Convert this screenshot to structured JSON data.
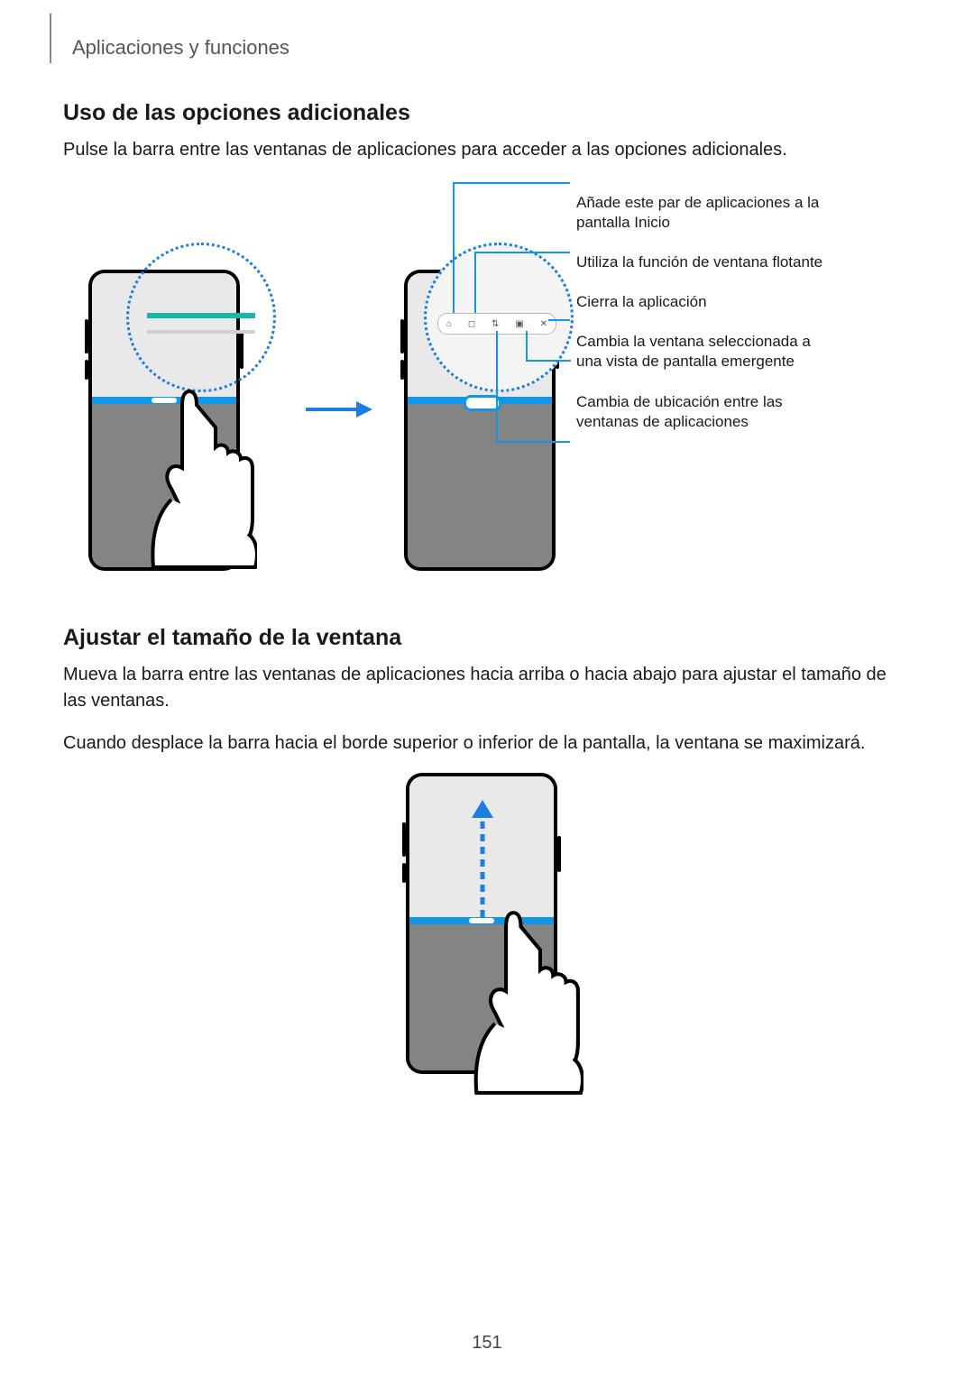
{
  "breadcrumb": "Aplicaciones y funciones",
  "section1": {
    "heading": "Uso de las opciones adicionales",
    "paragraph": "Pulse la barra entre las ventanas de aplicaciones para acceder a las opciones adicionales."
  },
  "callouts": [
    "Añade este par de aplicaciones a la pantalla Inicio",
    "Utiliza la función de ventana flotante",
    "Cierra la aplicación",
    "Cambia la ventana seleccionada a una vista de pantalla emergente",
    "Cambia de ubicación entre las ventanas de aplicaciones"
  ],
  "section2": {
    "heading": "Ajustar el tamaño de la ventana",
    "p1": "Mueva la barra entre las ventanas de aplicaciones hacia arriba o hacia abajo para ajustar el tamaño de las ventanas.",
    "p2": "Cuando desplace la barra hacia el borde superior o inferior de la pantalla, la ventana se maximizará."
  },
  "page_number": "151"
}
